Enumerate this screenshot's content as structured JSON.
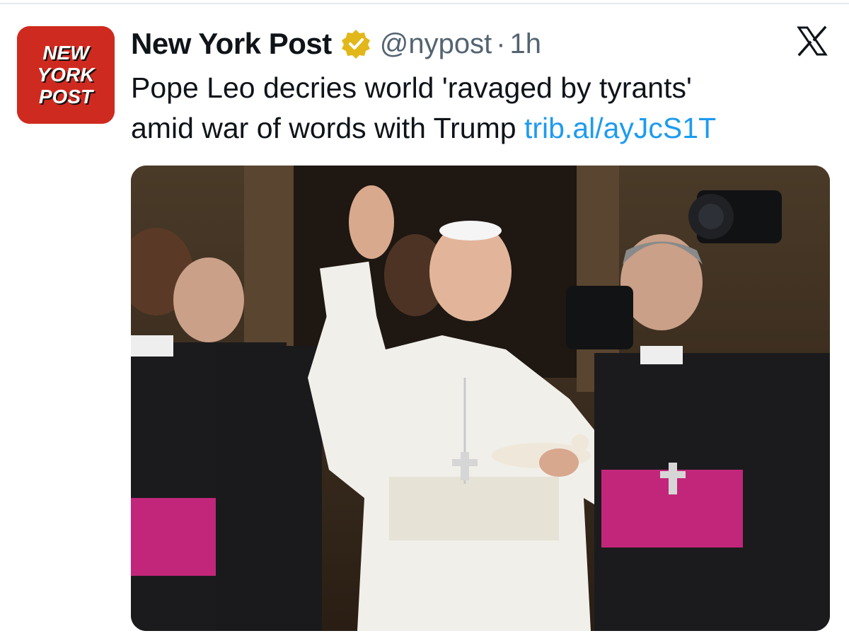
{
  "account": {
    "name": "New York Post",
    "handle": "@nypost",
    "separator": "·",
    "time": "1h",
    "logo_lines": [
      "NEW",
      "YORK",
      "POST"
    ],
    "brand_color": "#cf2a1f",
    "verified_badge_color": "#e2b719"
  },
  "tweet": {
    "text_line1": "Pope Leo decries world 'ravaged by tyrants'",
    "text_line2": "amid war of words with Trump",
    "link": "trib.al/ayJcS1T",
    "link_color": "#1d9bf0"
  },
  "icons": {
    "avatar": "new-york-post-logo",
    "verified": "gold-verified-badge-icon",
    "platform": "x-logo-icon"
  }
}
